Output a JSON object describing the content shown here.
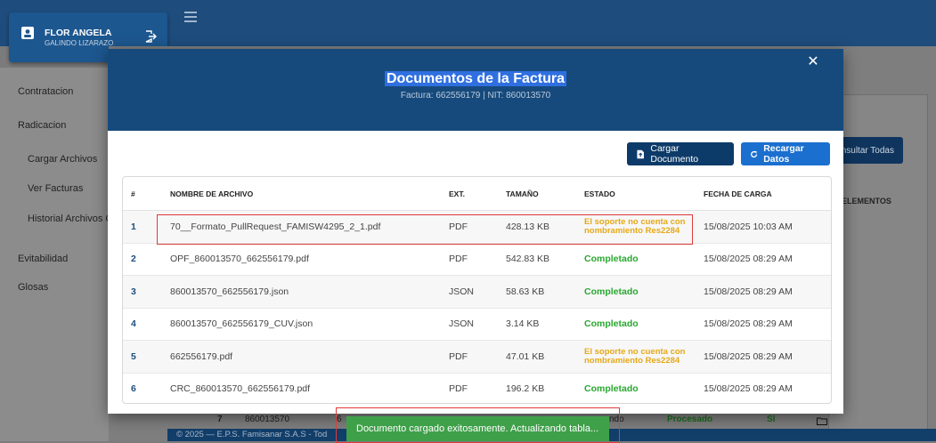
{
  "user": {
    "name": "FLOR ANGELA",
    "surname": "GALINDO LIZARAZO"
  },
  "sidebar": {
    "items": [
      {
        "label": "Contratacion"
      },
      {
        "label": "Radicacion"
      },
      {
        "label": "Cargar Archivos"
      },
      {
        "label": "Ver Facturas"
      },
      {
        "label": "Historial Archivos Ca"
      },
      {
        "label": "Evitabilidad"
      },
      {
        "label": "Glosas"
      }
    ]
  },
  "background": {
    "consultar_label": "Consultar Todas",
    "col_header": "ELEMENTOS",
    "row": {
      "index": "7",
      "nit": "860013570",
      "fragment": "6",
      "status_fragment": "ndo",
      "processed": "Procesado",
      "yes": "SI"
    },
    "footer": "© 2025 — E.P.S. Famisanar S.A.S - Tod"
  },
  "modal": {
    "title": "Documentos de la Factura",
    "subtitle": "Factura: 662556179 | NIT: 860013570",
    "close_label": "✕",
    "upload_label": "Cargar Documento",
    "reload_label": "Recargar Datos"
  },
  "table": {
    "headers": [
      "#",
      "NOMBRE DE ARCHIVO",
      "EXT.",
      "TAMAÑO",
      "ESTADO",
      "FECHA DE CARGA"
    ],
    "rows": [
      {
        "index": "1",
        "name": "70__Formato_PullRequest_FAMISW4295_2_1.pdf",
        "ext": "PDF",
        "size": "428.13 KB",
        "status": "El soporte no cuenta con nombramiento Res2284",
        "date": "15/08/2025 10:03 AM"
      },
      {
        "index": "2",
        "name": "OPF_860013570_662556179.pdf",
        "ext": "PDF",
        "size": "542.83 KB",
        "status": "Completado",
        "date": "15/08/2025 08:29 AM"
      },
      {
        "index": "3",
        "name": "860013570_662556179.json",
        "ext": "JSON",
        "size": "58.63 KB",
        "status": "Completado",
        "date": "15/08/2025 08:29 AM"
      },
      {
        "index": "4",
        "name": "860013570_662556179_CUV.json",
        "ext": "JSON",
        "size": "3.14 KB",
        "status": "Completado",
        "date": "15/08/2025 08:29 AM"
      },
      {
        "index": "5",
        "name": "662556179.pdf",
        "ext": "PDF",
        "size": "47.01 KB",
        "status": "El soporte no cuenta con nombramiento Res2284",
        "date": "15/08/2025 08:29 AM"
      },
      {
        "index": "6",
        "name": "CRC_860013570_662556179.pdf",
        "ext": "PDF",
        "size": "196.2 KB",
        "status": "Completado",
        "date": "15/08/2025 08:29 AM"
      }
    ]
  },
  "toast": {
    "message": "Documento cargado exitosamente. Actualizando tabla..."
  },
  "colors": {
    "header": "#174a7c",
    "ok": "#28a72f",
    "warn": "#e6a817",
    "highlight": "#e03b3b",
    "toast": "#3fa04a"
  }
}
